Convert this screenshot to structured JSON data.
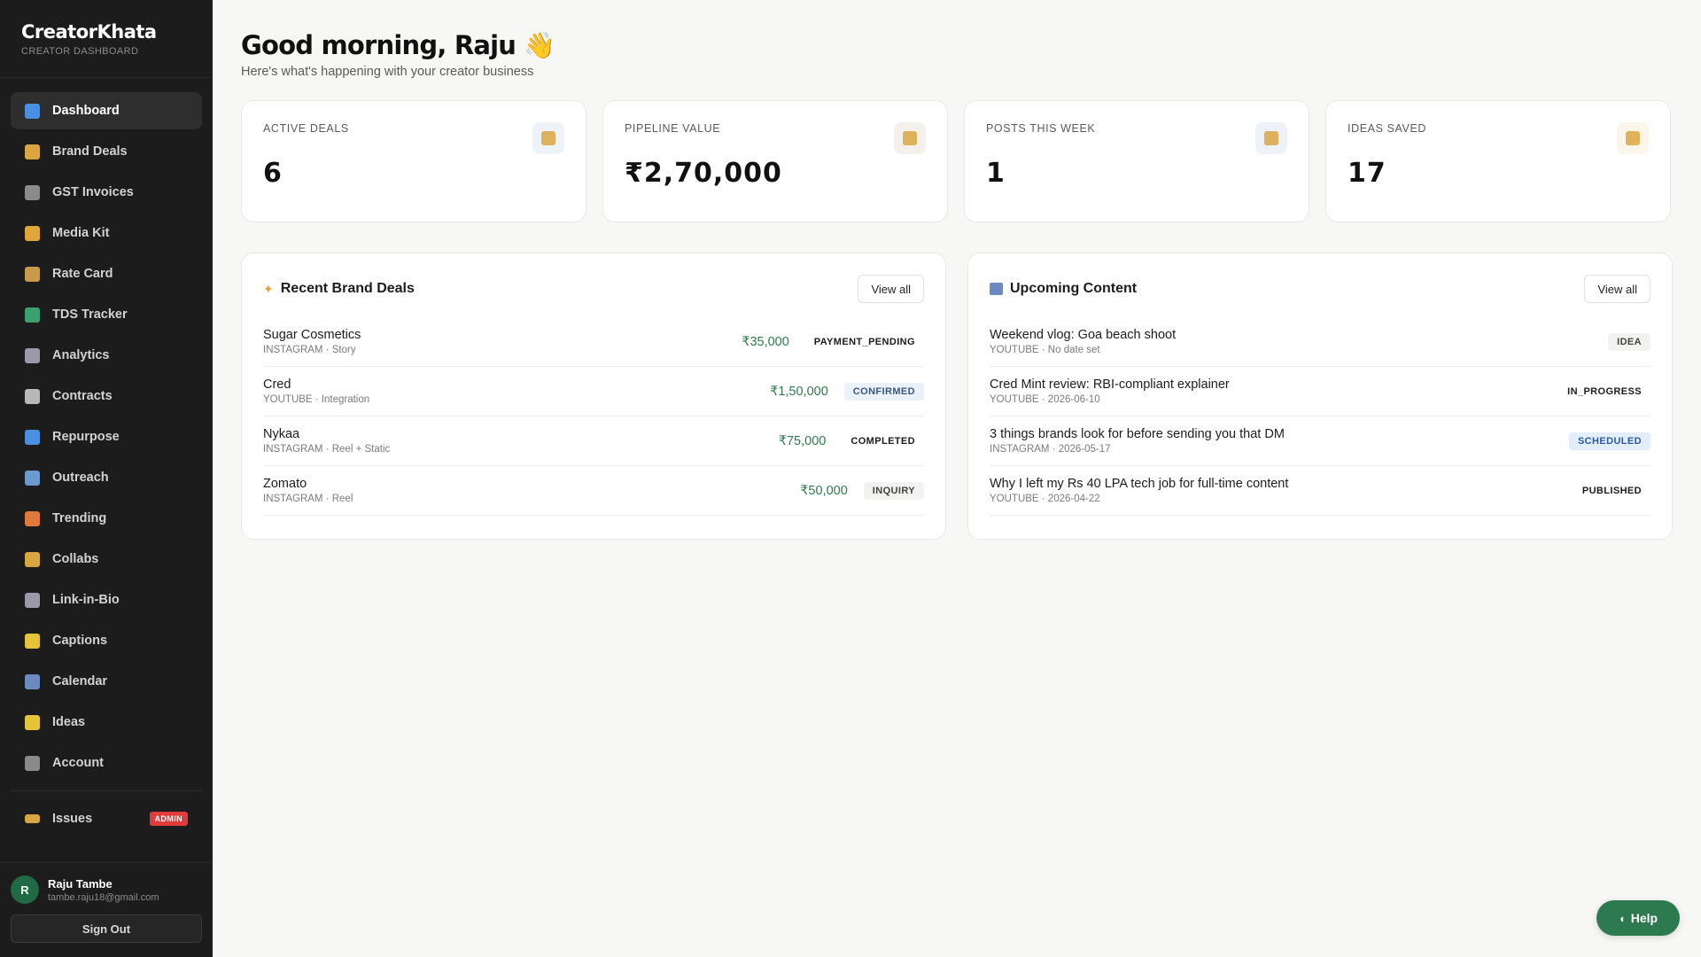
{
  "app": {
    "brand": "CreatorKhata",
    "brand_sub": "CREATOR DASHBOARD"
  },
  "sidebar": {
    "items": [
      {
        "label": "Dashboard",
        "icon": "chart-icon",
        "color": "#4a8fe0",
        "active": true
      },
      {
        "label": "Brand Deals",
        "icon": "handshake-icon",
        "color": "#d9a642"
      },
      {
        "label": "GST Invoices",
        "icon": "receipt-icon",
        "color": "#8a8a8a"
      },
      {
        "label": "Media Kit",
        "icon": "folder-icon",
        "color": "#e0a63a"
      },
      {
        "label": "Rate Card",
        "icon": "money-bag-icon",
        "color": "#c99a4a"
      },
      {
        "label": "TDS Tracker",
        "icon": "money-wings-icon",
        "color": "#3aa070"
      },
      {
        "label": "Analytics",
        "icon": "trend-chart-icon",
        "color": "#9a9aa8"
      },
      {
        "label": "Contracts",
        "icon": "document-icon",
        "color": "#b8b8b8"
      },
      {
        "label": "Repurpose",
        "icon": "repeat-icon",
        "color": "#4a8fe0"
      },
      {
        "label": "Outreach",
        "icon": "envelope-icon",
        "color": "#6a9ad0"
      },
      {
        "label": "Trending",
        "icon": "fire-icon",
        "color": "#e07a3a"
      },
      {
        "label": "Collabs",
        "icon": "handshake-icon",
        "color": "#d9a642"
      },
      {
        "label": "Link-in-Bio",
        "icon": "link-icon",
        "color": "#9a9aa8"
      },
      {
        "label": "Captions",
        "icon": "sparkle-icon",
        "color": "#e6c43a"
      },
      {
        "label": "Calendar",
        "icon": "calendar-icon",
        "color": "#6a8ac0"
      },
      {
        "label": "Ideas",
        "icon": "lightbulb-icon",
        "color": "#e6c43a"
      },
      {
        "label": "Account",
        "icon": "gear-icon",
        "color": "#8a8a8a"
      }
    ],
    "issues": {
      "label": "Issues",
      "badge": "ADMIN",
      "icon": "ticket-icon",
      "color": "#d9a642"
    },
    "user": {
      "initial": "R",
      "name": "Raju Tambe",
      "email": "tambe.raju18@gmail.com",
      "signout": "Sign Out"
    }
  },
  "header": {
    "greeting": "Good morning, Raju 👋",
    "subtitle": "Here's what's happening with your creator business"
  },
  "stats": [
    {
      "label": "ACTIVE DEALS",
      "value": "6",
      "icon": "handshake-icon",
      "bg": "#eef3f8"
    },
    {
      "label": "PIPELINE VALUE",
      "value": "₹2,70,000",
      "icon": "money-bag-icon",
      "bg": "#f4f1ec"
    },
    {
      "label": "POSTS THIS WEEK",
      "value": "1",
      "icon": "calendar-icon",
      "bg": "#eef2f8"
    },
    {
      "label": "IDEAS SAVED",
      "value": "17",
      "icon": "lightbulb-icon",
      "bg": "#faf7ea"
    }
  ],
  "deals": {
    "title": "Recent Brand Deals",
    "view_all": "View all",
    "rows": [
      {
        "name": "Sugar Cosmetics",
        "meta": "INSTAGRAM · Story",
        "amount": "₹35,000",
        "status": "PAYMENT_PENDING",
        "kind": "plain"
      },
      {
        "name": "Cred",
        "meta": "YOUTUBE · Integration",
        "amount": "₹1,50,000",
        "status": "CONFIRMED",
        "kind": "confirmed"
      },
      {
        "name": "Nykaa",
        "meta": "INSTAGRAM · Reel + Static",
        "amount": "₹75,000",
        "status": "COMPLETED",
        "kind": "plain"
      },
      {
        "name": "Zomato",
        "meta": "INSTAGRAM · Reel",
        "amount": "₹50,000",
        "status": "INQUIRY",
        "kind": "inquiry"
      }
    ]
  },
  "content": {
    "title": "Upcoming Content",
    "view_all": "View all",
    "rows": [
      {
        "title": "Weekend vlog: Goa beach shoot",
        "meta": "YOUTUBE · No date set",
        "status": "IDEA",
        "kind": "idea"
      },
      {
        "title": "Cred Mint review: RBI-compliant explainer",
        "meta": "YOUTUBE · 2026-06-10",
        "status": "IN_PROGRESS",
        "kind": "plain"
      },
      {
        "title": "3 things brands look for before sending you that DM",
        "meta": "INSTAGRAM · 2026-05-17",
        "status": "SCHEDULED",
        "kind": "scheduled"
      },
      {
        "title": "Why I left my Rs 40 LPA tech job for full-time content",
        "meta": "YOUTUBE · 2026-04-22",
        "status": "PUBLISHED",
        "kind": "plain"
      }
    ]
  },
  "help": {
    "label": "Help"
  }
}
